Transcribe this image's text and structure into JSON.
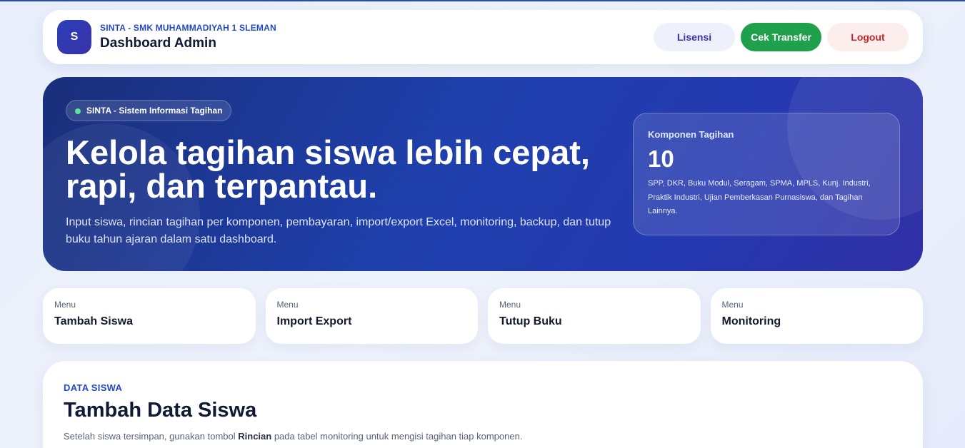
{
  "header": {
    "logo_letter": "S",
    "school": "SINTA - SMK MUHAMMADIYAH 1 SLEMAN",
    "title": "Dashboard Admin",
    "buttons": {
      "lisensi": "Lisensi",
      "cek_transfer": "Cek Transfer",
      "logout": "Logout"
    }
  },
  "hero": {
    "badge": "SINTA - Sistem Informasi Tagihan",
    "headline_line1": "Kelola tagihan siswa lebih cepat,",
    "headline_line2": "rapi, dan terpantau.",
    "lead": "Input siswa, rincian tagihan per komponen, pembayaran, import/export Excel, monitoring, backup, dan tutup buku tahun ajaran dalam satu dashboard.",
    "stat": {
      "label": "Komponen Tagihan",
      "value": "10",
      "description": "SPP, DKR, Buku Modul, Seragam, SPMA, MPLS, Kunj. Industri, Praktik Industri, Ujian Pemberkasan Purnasiswa, dan Tagihan Lainnya."
    }
  },
  "menus": [
    {
      "caption": "Menu",
      "label": "Tambah Siswa"
    },
    {
      "caption": "Menu",
      "label": "Import Export"
    },
    {
      "caption": "Menu",
      "label": "Tutup Buku"
    },
    {
      "caption": "Menu",
      "label": "Monitoring"
    }
  ],
  "data_section": {
    "eyebrow": "DATA SISWA",
    "heading": "Tambah Data Siswa",
    "note_before": "Setelah siswa tersimpan, gunakan tombol ",
    "note_bold": "Rincian",
    "note_after": " pada tabel monitoring untuk mengisi tagihan tiap komponen."
  },
  "colors": {
    "accent": "#2448c5",
    "success": "#1fa04a",
    "danger": "#c0282a",
    "hero_start": "#1a2f7a",
    "hero_end": "#3130a5"
  }
}
